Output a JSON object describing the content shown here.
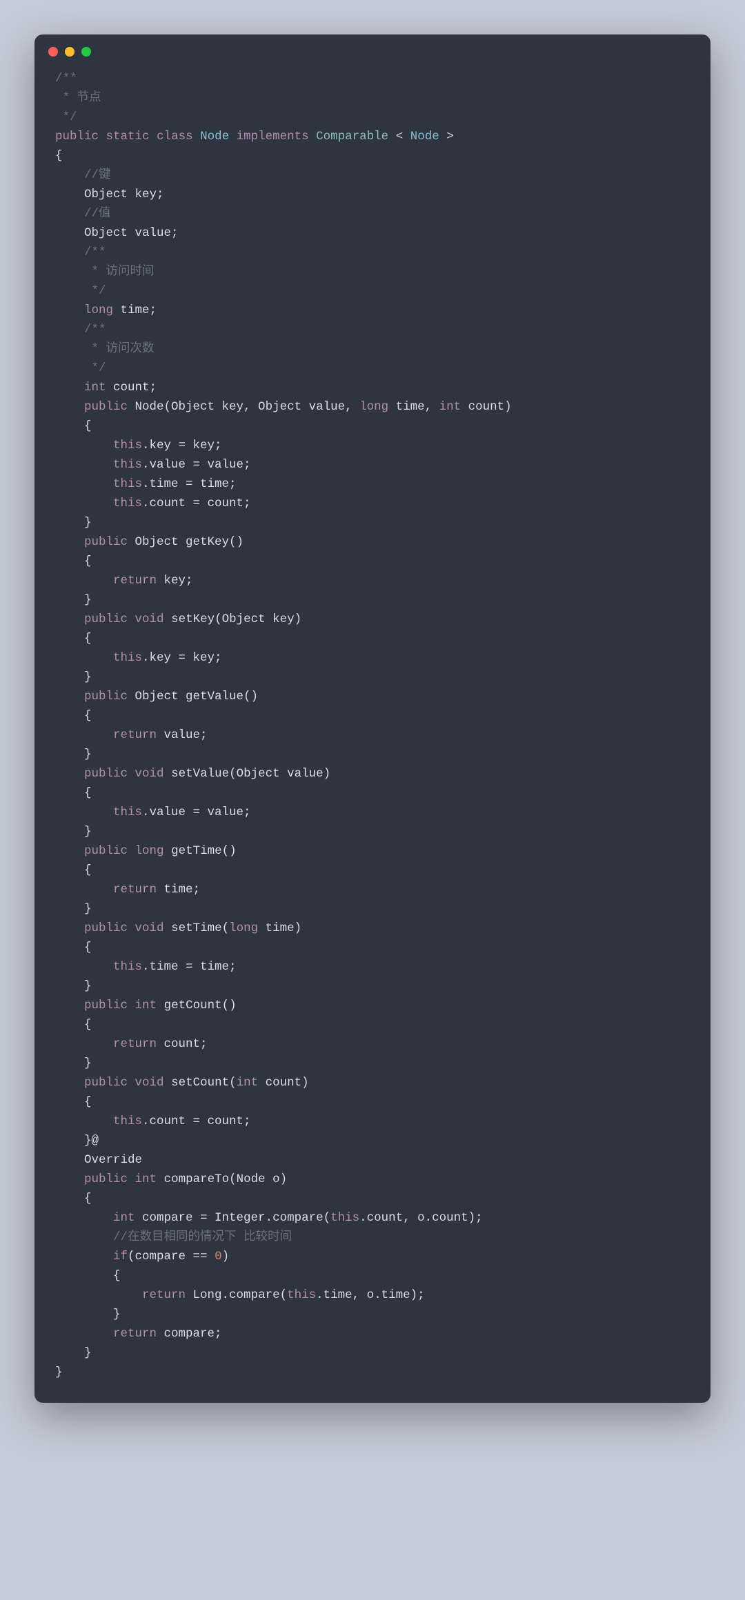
{
  "colors": {
    "background_page": "#c4cbd8",
    "background_window": "#2e3440",
    "text_default": "#d8dee9",
    "text_comment": "#6b7280",
    "text_keyword": "#b48ead",
    "text_type": "#8fbcbb",
    "text_class": "#88c0d0",
    "text_number": "#d08770",
    "dot_red": "#ff5f56",
    "dot_yellow": "#ffbd2e",
    "dot_green": "#27c93f"
  },
  "code_lines": [
    [
      [
        "comment",
        "/**"
      ]
    ],
    [
      [
        "comment",
        " * 节点"
      ]
    ],
    [
      [
        "comment",
        " */"
      ]
    ],
    [
      [
        "keyword",
        "public"
      ],
      [
        "default",
        " "
      ],
      [
        "keyword",
        "static"
      ],
      [
        "default",
        " "
      ],
      [
        "keyword",
        "class"
      ],
      [
        "default",
        " "
      ],
      [
        "class",
        "Node"
      ],
      [
        "default",
        " "
      ],
      [
        "keyword",
        "implements"
      ],
      [
        "default",
        " "
      ],
      [
        "type",
        "Comparable"
      ],
      [
        "default",
        " < "
      ],
      [
        "class",
        "Node"
      ],
      [
        "default",
        " >"
      ]
    ],
    [
      [
        "default",
        "{"
      ]
    ],
    [
      [
        "default",
        "    "
      ],
      [
        "comment",
        "//键"
      ]
    ],
    [
      [
        "default",
        "    Object key;"
      ]
    ],
    [
      [
        "default",
        "    "
      ],
      [
        "comment",
        "//值"
      ]
    ],
    [
      [
        "default",
        "    Object value;"
      ]
    ],
    [
      [
        "default",
        "    "
      ],
      [
        "comment",
        "/**"
      ]
    ],
    [
      [
        "default",
        "    "
      ],
      [
        "comment",
        " * 访问时间"
      ]
    ],
    [
      [
        "default",
        "    "
      ],
      [
        "comment",
        " */"
      ]
    ],
    [
      [
        "default",
        "    "
      ],
      [
        "keyword",
        "long"
      ],
      [
        "default",
        " time;"
      ]
    ],
    [
      [
        "default",
        "    "
      ],
      [
        "comment",
        "/**"
      ]
    ],
    [
      [
        "default",
        "    "
      ],
      [
        "comment",
        " * 访问次数"
      ]
    ],
    [
      [
        "default",
        "    "
      ],
      [
        "comment",
        " */"
      ]
    ],
    [
      [
        "default",
        "    "
      ],
      [
        "keyword",
        "int"
      ],
      [
        "default",
        " count;"
      ]
    ],
    [
      [
        "default",
        "    "
      ],
      [
        "keyword",
        "public"
      ],
      [
        "default",
        " Node(Object key, Object value, "
      ],
      [
        "keyword",
        "long"
      ],
      [
        "default",
        " time, "
      ],
      [
        "keyword",
        "int"
      ],
      [
        "default",
        " count)"
      ]
    ],
    [
      [
        "default",
        "    {"
      ]
    ],
    [
      [
        "default",
        "        "
      ],
      [
        "keyword",
        "this"
      ],
      [
        "default",
        ".key = key;"
      ]
    ],
    [
      [
        "default",
        "        "
      ],
      [
        "keyword",
        "this"
      ],
      [
        "default",
        ".value = value;"
      ]
    ],
    [
      [
        "default",
        "        "
      ],
      [
        "keyword",
        "this"
      ],
      [
        "default",
        ".time = time;"
      ]
    ],
    [
      [
        "default",
        "        "
      ],
      [
        "keyword",
        "this"
      ],
      [
        "default",
        ".count = count;"
      ]
    ],
    [
      [
        "default",
        "    }"
      ]
    ],
    [
      [
        "default",
        "    "
      ],
      [
        "keyword",
        "public"
      ],
      [
        "default",
        " Object getKey()"
      ]
    ],
    [
      [
        "default",
        "    {"
      ]
    ],
    [
      [
        "default",
        "        "
      ],
      [
        "keyword",
        "return"
      ],
      [
        "default",
        " key;"
      ]
    ],
    [
      [
        "default",
        "    }"
      ]
    ],
    [
      [
        "default",
        "    "
      ],
      [
        "keyword",
        "public"
      ],
      [
        "default",
        " "
      ],
      [
        "keyword",
        "void"
      ],
      [
        "default",
        " setKey(Object key)"
      ]
    ],
    [
      [
        "default",
        "    {"
      ]
    ],
    [
      [
        "default",
        "        "
      ],
      [
        "keyword",
        "this"
      ],
      [
        "default",
        ".key = key;"
      ]
    ],
    [
      [
        "default",
        "    }"
      ]
    ],
    [
      [
        "default",
        "    "
      ],
      [
        "keyword",
        "public"
      ],
      [
        "default",
        " Object getValue()"
      ]
    ],
    [
      [
        "default",
        "    {"
      ]
    ],
    [
      [
        "default",
        "        "
      ],
      [
        "keyword",
        "return"
      ],
      [
        "default",
        " value;"
      ]
    ],
    [
      [
        "default",
        "    }"
      ]
    ],
    [
      [
        "default",
        "    "
      ],
      [
        "keyword",
        "public"
      ],
      [
        "default",
        " "
      ],
      [
        "keyword",
        "void"
      ],
      [
        "default",
        " setValue(Object value)"
      ]
    ],
    [
      [
        "default",
        "    {"
      ]
    ],
    [
      [
        "default",
        "        "
      ],
      [
        "keyword",
        "this"
      ],
      [
        "default",
        ".value = value;"
      ]
    ],
    [
      [
        "default",
        "    }"
      ]
    ],
    [
      [
        "default",
        "    "
      ],
      [
        "keyword",
        "public"
      ],
      [
        "default",
        " "
      ],
      [
        "keyword",
        "long"
      ],
      [
        "default",
        " getTime()"
      ]
    ],
    [
      [
        "default",
        "    {"
      ]
    ],
    [
      [
        "default",
        "        "
      ],
      [
        "keyword",
        "return"
      ],
      [
        "default",
        " time;"
      ]
    ],
    [
      [
        "default",
        "    }"
      ]
    ],
    [
      [
        "default",
        "    "
      ],
      [
        "keyword",
        "public"
      ],
      [
        "default",
        " "
      ],
      [
        "keyword",
        "void"
      ],
      [
        "default",
        " setTime("
      ],
      [
        "keyword",
        "long"
      ],
      [
        "default",
        " time)"
      ]
    ],
    [
      [
        "default",
        "    {"
      ]
    ],
    [
      [
        "default",
        "        "
      ],
      [
        "keyword",
        "this"
      ],
      [
        "default",
        ".time = time;"
      ]
    ],
    [
      [
        "default",
        "    }"
      ]
    ],
    [
      [
        "default",
        "    "
      ],
      [
        "keyword",
        "public"
      ],
      [
        "default",
        " "
      ],
      [
        "keyword",
        "int"
      ],
      [
        "default",
        " getCount()"
      ]
    ],
    [
      [
        "default",
        "    {"
      ]
    ],
    [
      [
        "default",
        "        "
      ],
      [
        "keyword",
        "return"
      ],
      [
        "default",
        " count;"
      ]
    ],
    [
      [
        "default",
        "    }"
      ]
    ],
    [
      [
        "default",
        "    "
      ],
      [
        "keyword",
        "public"
      ],
      [
        "default",
        " "
      ],
      [
        "keyword",
        "void"
      ],
      [
        "default",
        " setCount("
      ],
      [
        "keyword",
        "int"
      ],
      [
        "default",
        " count)"
      ]
    ],
    [
      [
        "default",
        "    {"
      ]
    ],
    [
      [
        "default",
        "        "
      ],
      [
        "keyword",
        "this"
      ],
      [
        "default",
        ".count = count;"
      ]
    ],
    [
      [
        "default",
        "    }@"
      ]
    ],
    [
      [
        "default",
        "    Override"
      ]
    ],
    [
      [
        "default",
        "    "
      ],
      [
        "keyword",
        "public"
      ],
      [
        "default",
        " "
      ],
      [
        "keyword",
        "int"
      ],
      [
        "default",
        " compareTo(Node o)"
      ]
    ],
    [
      [
        "default",
        "    {"
      ]
    ],
    [
      [
        "default",
        "        "
      ],
      [
        "keyword",
        "int"
      ],
      [
        "default",
        " compare = Integer.compare("
      ],
      [
        "keyword",
        "this"
      ],
      [
        "default",
        ".count, o.count);"
      ]
    ],
    [
      [
        "default",
        "        "
      ],
      [
        "comment",
        "//在数目相同的情况下 比较时间"
      ]
    ],
    [
      [
        "default",
        "        "
      ],
      [
        "keyword",
        "if"
      ],
      [
        "default",
        "(compare == "
      ],
      [
        "num",
        "0"
      ],
      [
        "default",
        ")"
      ]
    ],
    [
      [
        "default",
        "        {"
      ]
    ],
    [
      [
        "default",
        "            "
      ],
      [
        "keyword",
        "return"
      ],
      [
        "default",
        " Long.compare("
      ],
      [
        "keyword",
        "this"
      ],
      [
        "default",
        ".time, o.time);"
      ]
    ],
    [
      [
        "default",
        "        }"
      ]
    ],
    [
      [
        "default",
        "        "
      ],
      [
        "keyword",
        "return"
      ],
      [
        "default",
        " compare;"
      ]
    ],
    [
      [
        "default",
        "    }"
      ]
    ],
    [
      [
        "default",
        "}"
      ]
    ]
  ]
}
